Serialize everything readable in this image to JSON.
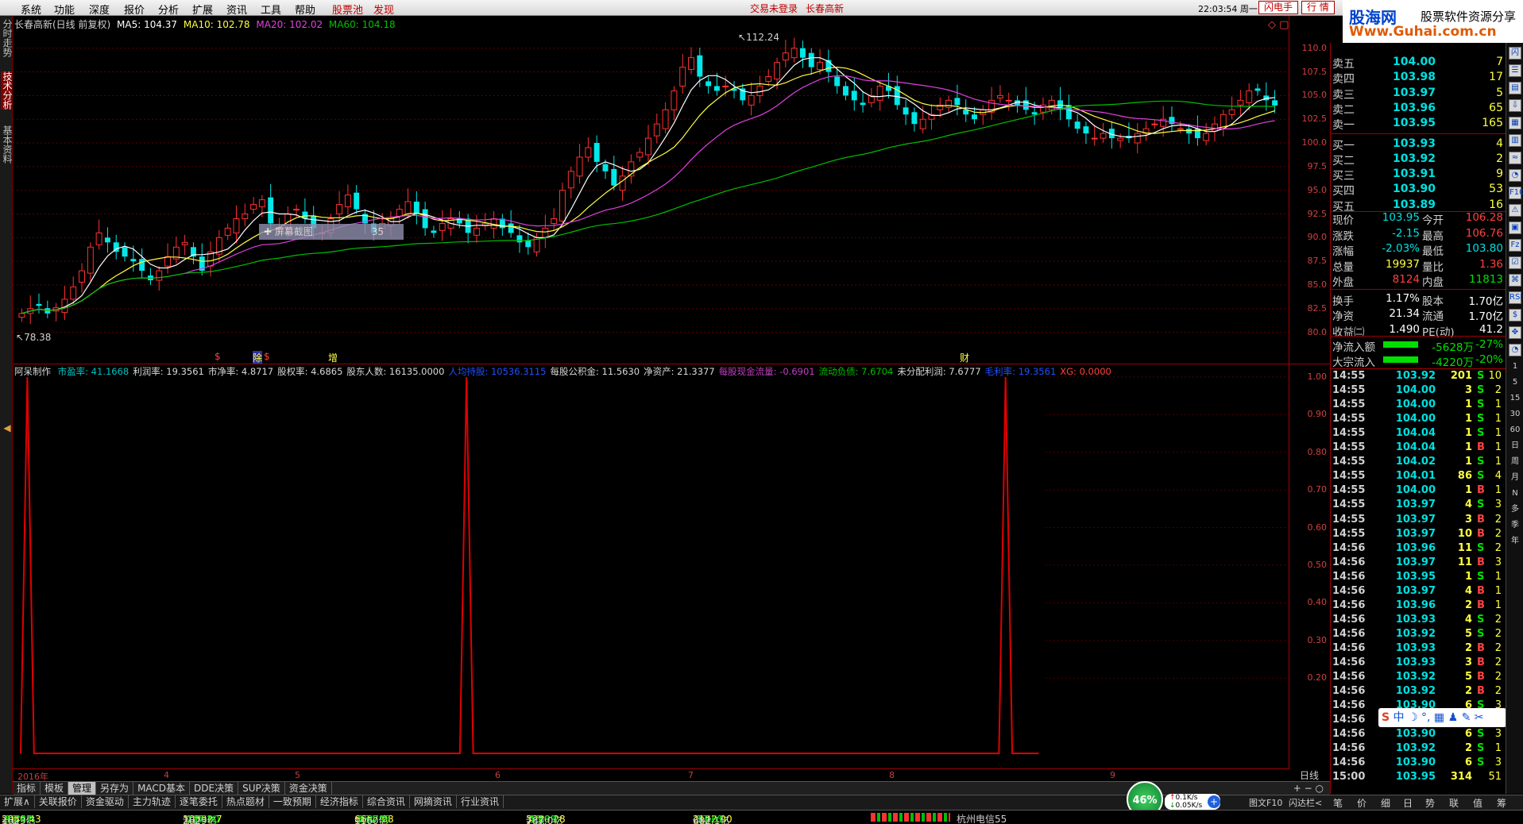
{
  "menu": {
    "items": [
      "系统",
      "功能",
      "深度",
      "报价",
      "分析",
      "扩展",
      "资讯",
      "工具",
      "帮助"
    ],
    "stock_pool": "股票池",
    "discover": "发现",
    "trade_status": "交易未登录",
    "stock_name": "长春高新",
    "clock": "22:03:54 周一",
    "flash_trade": "闪电手",
    "quotes": "行 情"
  },
  "brand": {
    "name": "股海网",
    "slogan": "股票软件资源分享",
    "url": "Www.Guhai.com.cn"
  },
  "left_tabs": [
    "分时走势",
    "技术分析",
    "基本资料"
  ],
  "chart": {
    "title": "长春高新(日线 前复权)",
    "ma5": "MA5: 104.37",
    "ma10": "MA10: 102.78",
    "ma20": "MA20: 102.02",
    "ma60": "MA60: 104.18",
    "high_marker": "112.24",
    "low_marker": "78.38",
    "tooltip": "屏幕截图",
    "tooltip_num": "35",
    "event_marks": [
      {
        "text": "$",
        "color": "#ff4040"
      },
      {
        "text": "除",
        "color": "#ffff40"
      },
      {
        "text": "$",
        "color": "#ff4040"
      },
      {
        "text": "增",
        "color": "#ffff40"
      },
      {
        "text": "财",
        "color": "#ffff40"
      }
    ]
  },
  "indicator": {
    "name": "阿呆制作",
    "fields": [
      {
        "text": "市盈率: 41.1668",
        "color": "#00c0c0"
      },
      {
        "text": "利润率: 19.3561",
        "color": "#d8d8d8"
      },
      {
        "text": "市净率: 4.8717",
        "color": "#d8d8d8"
      },
      {
        "text": "股权率: 4.6865",
        "color": "#d8d8d8"
      },
      {
        "text": "股东人数: 16135.0000",
        "color": "#d8d8d8"
      },
      {
        "text": "人均持股: 10536.3115",
        "color": "#2050ff"
      },
      {
        "text": "每股公积金: 11.5630",
        "color": "#d8d8d8"
      },
      {
        "text": "净资产: 21.3377",
        "color": "#d8d8d8"
      },
      {
        "text": "每股现金流量: -0.6901",
        "color": "#c040c0"
      },
      {
        "text": "流动负债: 7.6704",
        "color": "#00c000"
      },
      {
        "text": "未分配利润: 7.6777",
        "color": "#d8d8d8"
      },
      {
        "text": "毛利率: 19.3561",
        "color": "#2050ff"
      },
      {
        "text": "XG: 0.0000",
        "color": "#ff4040"
      }
    ]
  },
  "dates": [
    "2016年",
    "4",
    "5",
    "6",
    "7",
    "8",
    "9"
  ],
  "period": "日线",
  "tabs_row1": [
    "指标",
    "模板",
    "管理",
    "另存为",
    "MACD基本",
    "DDE决策",
    "SUP决策",
    "资金决策"
  ],
  "tabs_row2": [
    "扩展∧",
    "关联报价",
    "资金驱动",
    "主力轨迹",
    "逐笔委托",
    "热点题材",
    "一致预期",
    "经济指标",
    "综合资讯",
    "网摘资讯",
    "行业资讯"
  ],
  "status": {
    "sh": {
      "label": "上证",
      "value": "2980.43",
      "chg": "-53.47",
      "pct": "-1.76%",
      "amt": "1623亿"
    },
    "sz": {
      "label": "深证",
      "value": "10392.7",
      "chg": "-217.00",
      "pct": "-2.05%",
      "amt": "2629亿"
    },
    "zx": {
      "label": "中小",
      "value": "6667.08",
      "chg": "-154.95",
      "pct": "-2.27%",
      "amt": "1160亿"
    },
    "hs": {
      "label": "沪深",
      "value": "3220.28",
      "chg": "-55.39",
      "pct": "-1.69%",
      "amt": "787.0亿"
    },
    "cy": {
      "label": "创业",
      "value": "2122.90",
      "chg": "-33.61",
      "pct": "-1.56%",
      "amt": "682.1亿"
    },
    "server": "杭州电信55",
    "gauge": "46%",
    "speed_up": "0.1K/s",
    "speed_down": "0.05K/s",
    "right_tabs": [
      "图文F10",
      "闪达栏<",
      "笔",
      "价",
      "细",
      "日",
      "势",
      "联",
      "值",
      "筹"
    ]
  },
  "orderbook": {
    "sell": [
      {
        "label": "卖五",
        "price": "104.00",
        "vol": "7"
      },
      {
        "label": "卖四",
        "price": "103.98",
        "vol": "17"
      },
      {
        "label": "卖三",
        "price": "103.97",
        "vol": "5"
      },
      {
        "label": "卖二",
        "price": "103.96",
        "vol": "65"
      },
      {
        "label": "卖一",
        "price": "103.95",
        "vol": "165"
      }
    ],
    "buy": [
      {
        "label": "买一",
        "price": "103.93",
        "vol": "4"
      },
      {
        "label": "买二",
        "price": "103.92",
        "vol": "2"
      },
      {
        "label": "买三",
        "price": "103.91",
        "vol": "9"
      },
      {
        "label": "买四",
        "price": "103.90",
        "vol": "53"
      },
      {
        "label": "买五",
        "price": "103.89",
        "vol": "16"
      }
    ]
  },
  "quote": [
    {
      "l1": "现价",
      "v1": "103.95",
      "c1": "#00e0e0",
      "l2": "今开",
      "v2": "106.28",
      "c2": "#ff4040"
    },
    {
      "l1": "涨跌",
      "v1": "-2.15",
      "c1": "#00e0e0",
      "l2": "最高",
      "v2": "106.76",
      "c2": "#ff4040"
    },
    {
      "l1": "涨幅",
      "v1": "-2.03%",
      "c1": "#00e0e0",
      "l2": "最低",
      "v2": "103.80",
      "c2": "#00e0e0"
    },
    {
      "l1": "总量",
      "v1": "19937",
      "c1": "#ffff40",
      "l2": "量比",
      "v2": "1.36",
      "c2": "#ff4040"
    },
    {
      "l1": "外盘",
      "v1": "8124",
      "c1": "#ff4040",
      "l2": "内盘",
      "v2": "11813",
      "c2": "#00e000"
    },
    {
      "l1": "换手",
      "v1": "1.17%",
      "c1": "#ffffff",
      "l2": "股本",
      "v2": "1.70亿",
      "c2": "#ffffff"
    },
    {
      "l1": "净资",
      "v1": "21.34",
      "c1": "#ffffff",
      "l2": "流通",
      "v2": "1.70亿",
      "c2": "#ffffff"
    },
    {
      "l1": "收益㈡",
      "v1": "1.490",
      "c1": "#ffffff",
      "l2": "PE(动)",
      "v2": "41.2",
      "c2": "#ffffff"
    }
  ],
  "flows": [
    {
      "label": "净流入额",
      "value": "-5628万",
      "pct": "-27%"
    },
    {
      "label": "大宗流入",
      "value": "-4220万",
      "pct": "-20%"
    }
  ],
  "ticks": [
    {
      "t": "14:55",
      "p": "103.92",
      "v": "201",
      "s": "S",
      "n": "10"
    },
    {
      "t": "14:55",
      "p": "104.00",
      "v": "3",
      "s": "S",
      "n": "2"
    },
    {
      "t": "14:55",
      "p": "104.00",
      "v": "1",
      "s": "S",
      "n": "1"
    },
    {
      "t": "14:55",
      "p": "104.00",
      "v": "1",
      "s": "S",
      "n": "1"
    },
    {
      "t": "14:55",
      "p": "104.04",
      "v": "1",
      "s": "S",
      "n": "1"
    },
    {
      "t": "14:55",
      "p": "104.04",
      "v": "1",
      "s": "B",
      "n": "1"
    },
    {
      "t": "14:55",
      "p": "104.02",
      "v": "1",
      "s": "S",
      "n": "1"
    },
    {
      "t": "14:55",
      "p": "104.01",
      "v": "86",
      "s": "S",
      "n": "4"
    },
    {
      "t": "14:55",
      "p": "104.00",
      "v": "1",
      "s": "B",
      "n": "1"
    },
    {
      "t": "14:55",
      "p": "103.97",
      "v": "4",
      "s": "S",
      "n": "3"
    },
    {
      "t": "14:55",
      "p": "103.97",
      "v": "3",
      "s": "B",
      "n": "2"
    },
    {
      "t": "14:55",
      "p": "103.97",
      "v": "10",
      "s": "B",
      "n": "2"
    },
    {
      "t": "14:56",
      "p": "103.96",
      "v": "11",
      "s": "S",
      "n": "2"
    },
    {
      "t": "14:56",
      "p": "103.97",
      "v": "11",
      "s": "B",
      "n": "3"
    },
    {
      "t": "14:56",
      "p": "103.95",
      "v": "1",
      "s": "S",
      "n": "1"
    },
    {
      "t": "14:56",
      "p": "103.97",
      "v": "4",
      "s": "B",
      "n": "1"
    },
    {
      "t": "14:56",
      "p": "103.96",
      "v": "2",
      "s": "B",
      "n": "1"
    },
    {
      "t": "14:56",
      "p": "103.93",
      "v": "4",
      "s": "S",
      "n": "2"
    },
    {
      "t": "14:56",
      "p": "103.92",
      "v": "5",
      "s": "S",
      "n": "2"
    },
    {
      "t": "14:56",
      "p": "103.93",
      "v": "2",
      "s": "B",
      "n": "2"
    },
    {
      "t": "14:56",
      "p": "103.93",
      "v": "3",
      "s": "B",
      "n": "2"
    },
    {
      "t": "14:56",
      "p": "103.92",
      "v": "5",
      "s": "B",
      "n": "2"
    },
    {
      "t": "14:56",
      "p": "103.92",
      "v": "2",
      "s": "B",
      "n": "2"
    },
    {
      "t": "14:56",
      "p": "103.90",
      "v": "6",
      "s": "S",
      "n": "3"
    },
    {
      "t": "14:56",
      "p": "103.90",
      "v": "25",
      "s": "S",
      "n": "5"
    },
    {
      "t": "14:56",
      "p": "103.90",
      "v": "6",
      "s": "S",
      "n": "3"
    },
    {
      "t": "14:56",
      "p": "103.92",
      "v": "2",
      "s": "S",
      "n": "1"
    },
    {
      "t": "14:56",
      "p": "103.90",
      "v": "6",
      "s": "S",
      "n": "3"
    },
    {
      "t": "15:00",
      "p": "103.95",
      "v": "314",
      "s": "",
      "n": "51"
    }
  ],
  "tool_icons": [
    "闪",
    "☰",
    "▤",
    "⇩",
    "▦",
    "▥",
    "≈",
    "◔",
    "F10",
    "⚠",
    "▣",
    "Fz",
    "☑",
    "⌘",
    "RSI",
    "$",
    "✥",
    "◔",
    "1",
    "5",
    "15",
    "30",
    "60",
    "日",
    "周",
    "月",
    "N",
    "多",
    "季",
    "年"
  ],
  "chart_data": [
    {
      "type": "candlestick",
      "title": "长春高新(日线 前复权)",
      "ylim": [
        78.38,
        112.24
      ],
      "yticks": [
        80.0,
        82.5,
        85.0,
        87.5,
        90.0,
        92.5,
        95.0,
        97.5,
        100.0,
        102.5,
        105.0,
        107.5,
        110.0
      ],
      "x_ticks": [
        "2016年",
        "4",
        "5",
        "6",
        "7",
        "8",
        "9"
      ],
      "close_approx": [
        82.0,
        82.5,
        82.8,
        82.0,
        82.6,
        83.5,
        84.8,
        86.5,
        89.0,
        90.5,
        89.5,
        88.5,
        88.0,
        87.5,
        86.5,
        85.5,
        86.5,
        88.0,
        89.0,
        89.5,
        88.0,
        86.5,
        88.5,
        90.0,
        91.0,
        92.0,
        92.5,
        93.5,
        94.0,
        91.5,
        91.0,
        92.5,
        93.0,
        92.0,
        91.0,
        90.5,
        92.0,
        93.5,
        94.5,
        93.0,
        91.5,
        90.5,
        91.5,
        92.0,
        93.0,
        93.8,
        92.5,
        91.0,
        90.5,
        91.5,
        92.0,
        91.5,
        90.5,
        91.0,
        91.5,
        92.0,
        91.0,
        90.5,
        89.5,
        89.0,
        90.0,
        91.0,
        92.0,
        95.0,
        97.0,
        98.5,
        99.5,
        98.0,
        97.0,
        95.5,
        96.5,
        98.0,
        99.0,
        100.5,
        102.0,
        103.5,
        105.5,
        108.0,
        109.0,
        107.0,
        106.0,
        105.5,
        106.0,
        105.5,
        104.5,
        105.0,
        106.0,
        107.0,
        108.5,
        109.5,
        110.0,
        109.0,
        108.0,
        108.5,
        107.5,
        106.0,
        105.0,
        104.5,
        104.0,
        105.0,
        106.0,
        105.5,
        104.0,
        103.0,
        102.0,
        102.5,
        103.0,
        104.0,
        104.5,
        104.0,
        103.0,
        102.5,
        103.5,
        104.5,
        105.0,
        104.5,
        104.0,
        103.5,
        103.0,
        104.0,
        104.5,
        103.5,
        102.5,
        101.5,
        101.0,
        100.5,
        101.0,
        100.5,
        100.5,
        100.5,
        101.0,
        101.5,
        102.0,
        102.5,
        102.0,
        101.5,
        101.0,
        100.5,
        101.0,
        102.0,
        103.0,
        103.5,
        104.5,
        105.5,
        105.5,
        104.5,
        103.95
      ],
      "series": [
        {
          "name": "MA5",
          "value": 104.37,
          "color": "#ffffff"
        },
        {
          "name": "MA10",
          "value": 102.78,
          "color": "#ffff40"
        },
        {
          "name": "MA20",
          "value": 102.02,
          "color": "#e040e0"
        },
        {
          "name": "MA60",
          "value": 104.18,
          "color": "#00c000"
        }
      ],
      "annotations": [
        {
          "text": "112.24",
          "kind": "high"
        },
        {
          "text": "78.38",
          "kind": "low"
        }
      ]
    },
    {
      "type": "line",
      "title": "阿呆制作",
      "ylim": [
        0,
        1.0
      ],
      "yticks": [
        0.2,
        0.3,
        0.4,
        0.5,
        0.6,
        0.7,
        0.8,
        0.9,
        1.0
      ],
      "series": [
        {
          "name": "XG",
          "color": "#e00000",
          "spikes_at_bar": [
            1,
            67,
            148
          ],
          "total_bars": 154
        }
      ]
    }
  ]
}
